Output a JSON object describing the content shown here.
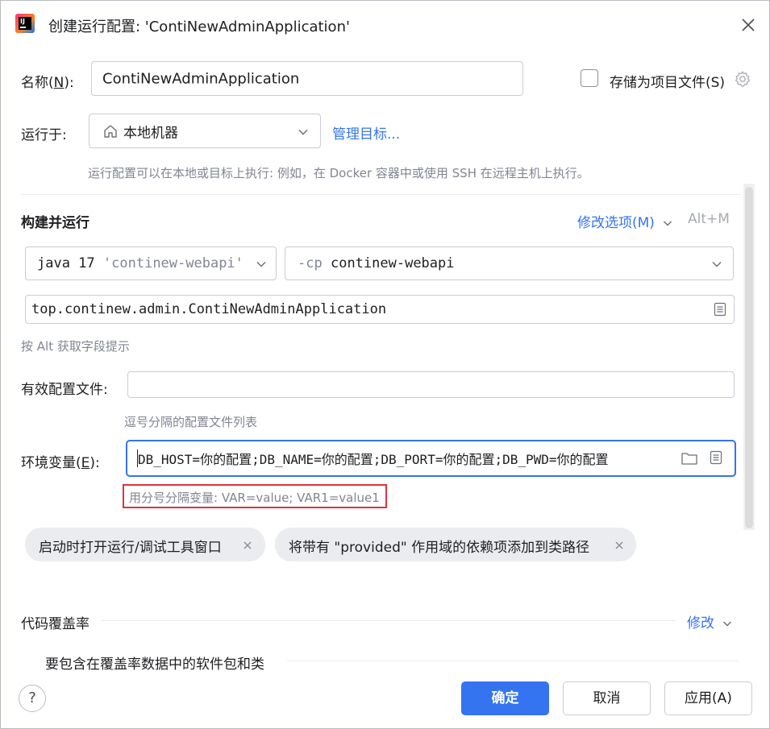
{
  "window": {
    "title": "创建运行配置: 'ContiNewAdminApplication'"
  },
  "name_row": {
    "label": "名称(",
    "mnemonic": "N",
    "label_end": "):",
    "value": "ContiNewAdminApplication"
  },
  "store_option": {
    "label": "存储为项目文件(S)",
    "checked": false
  },
  "run_on": {
    "label": "运行于:",
    "selected": "本地机器",
    "manage_link": "管理目标...",
    "hint": "运行配置可以在本地或目标上执行: 例如，在 Docker 容器中或使用 SSH 在远程主机上执行。"
  },
  "build_run": {
    "section_title": "构建并运行",
    "modify_options": "修改选项(M)",
    "shortcut": "Alt+M",
    "jdk_value": "java 17",
    "jdk_suffix": "'continew-webapi'",
    "cp_flag": "-cp",
    "cp_module": "continew-webapi",
    "main_class": "top.continew.admin.ContiNewAdminApplication",
    "alt_hint": "按 Alt 获取字段提示"
  },
  "profiles": {
    "label": "有效配置文件:",
    "value": "",
    "hint": "逗号分隔的配置文件列表"
  },
  "env": {
    "label": "环境变量(",
    "mnemonic": "E",
    "label_end": "):",
    "value": "DB_HOST=你的配置;DB_NAME=你的配置;DB_PORT=你的配置;DB_PWD=你的配置",
    "hint": "用分号分隔变量: VAR=value; VAR1=value1"
  },
  "chips": [
    {
      "label": "启动时打开运行/调试工具窗口"
    },
    {
      "label": "将带有 \"provided\" 作用域的依赖项添加到类路径"
    }
  ],
  "coverage": {
    "label": "代码覆盖率",
    "modify_link": "修改",
    "packages_label": "要包含在覆盖率数据中的软件包和类"
  },
  "buttons": {
    "help": "?",
    "ok": "确定",
    "cancel": "取消",
    "apply": "应用(A)"
  },
  "colors": {
    "accent": "#3574f0",
    "highlight_border": "#e0323c"
  }
}
